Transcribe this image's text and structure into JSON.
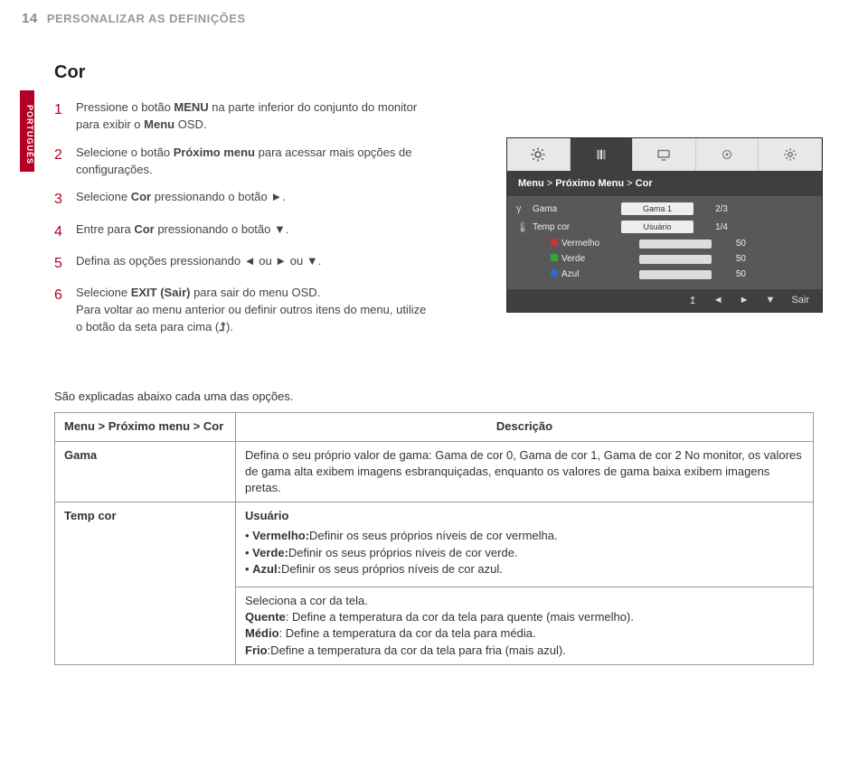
{
  "header": {
    "page_number": "14",
    "title": "PERSONALIZAR AS DEFINIÇÕES"
  },
  "sidetab": "PORTUGUÊS",
  "section_title": "Cor",
  "steps": [
    {
      "n": "1",
      "text_html": "Pressione o botão <b>MENU</b> na parte inferior do conjunto do monitor para exibir o <b>Menu</b> OSD."
    },
    {
      "n": "2",
      "text_html": "Selecione o botão <b>Próximo menu</b> para acessar mais opções de configurações."
    },
    {
      "n": "3",
      "text_html": "Selecione <b>Cor</b> pressionando o botão ►."
    },
    {
      "n": "4",
      "text_html": "Entre para <b>Cor</b> pressionando o botão ▼."
    },
    {
      "n": "5",
      "text_html": "Defina as opções pressionando ◄ ou ► ou ▼."
    },
    {
      "n": "6",
      "text_html": "Selecione <b>EXIT (Sair)</b> para sair do menu OSD.<br>Para voltar ao menu anterior ou definir outros itens do menu, utilize o botão da seta para cima (<b>&#x2BA5;</b>)."
    }
  ],
  "osd": {
    "breadcrumb": {
      "a": "Menu",
      "sep": ">",
      "b": "Próximo Menu",
      "c": "Cor"
    },
    "rows": {
      "gama": {
        "label": "Gama",
        "value": "Gama 1",
        "page": "2/3"
      },
      "tempcor": {
        "label": "Temp cor",
        "value": "Usuário",
        "page": "1/4"
      },
      "vermelho": {
        "label": "Vermelho",
        "num": "50"
      },
      "verde": {
        "label": "Verde",
        "num": "50"
      },
      "azul": {
        "label": "Azul",
        "num": "50"
      }
    },
    "nav": {
      "up": "↥",
      "left": "◄",
      "right": "►",
      "down": "▼",
      "exit": "Sair"
    }
  },
  "explain": "São explicadas abaixo cada uma das opções.",
  "table": {
    "head": {
      "left": "Menu > Próximo menu > Cor",
      "right": "Descrição"
    },
    "gama": {
      "name": "Gama",
      "desc": "Defina o seu próprio valor de gama: Gama de cor 0, Gama de cor 1, Gama de cor 2 No monitor, os valores de gama alta exibem imagens esbranquiçadas, enquanto os valores de gama baixa exibem imagens pretas."
    },
    "tempcor": {
      "name": "Temp cor",
      "user_label": "Usuário",
      "bullets": {
        "r": "Vermelho:Definir os seus próprios níveis de cor vermelha.",
        "g": "Verde:Definir os seus próprios níveis de cor verde.",
        "b": "Azul:Definir os seus próprios níveis de cor azul."
      },
      "sel": "Seleciona a cor da tela.",
      "quente": "Quente: Define a temperatura da cor da tela para quente (mais vermelho).",
      "medio": "Médio: Define a temperatura da cor da tela para média.",
      "frio": "Frio:Define a temperatura da cor da tela para fria (mais azul)."
    }
  }
}
